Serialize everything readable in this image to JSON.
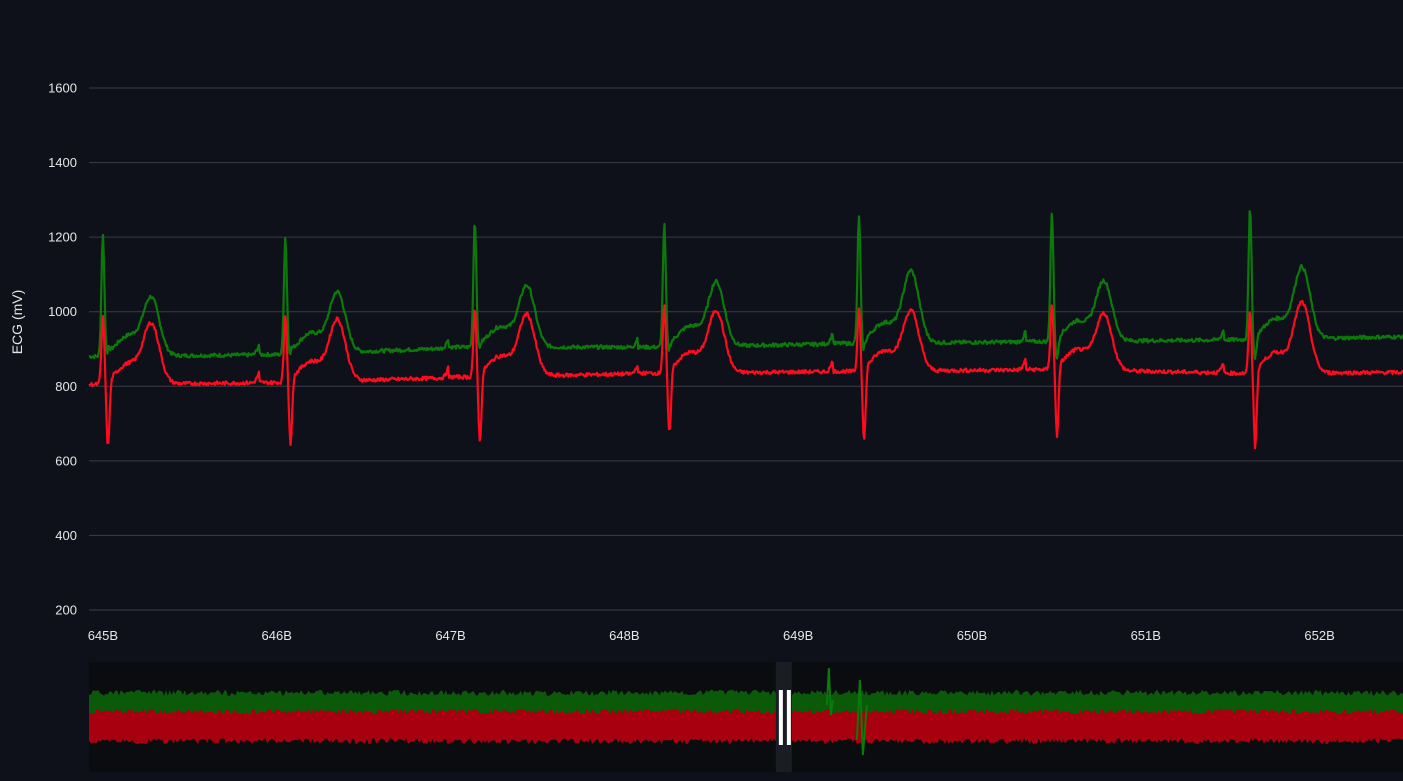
{
  "chart_data": {
    "type": "line",
    "ylabel": "ECG (mV)",
    "xlabel": "",
    "title": "",
    "ylim": [
      200,
      1600
    ],
    "yticks": [
      200,
      400,
      600,
      800,
      1000,
      1200,
      1400,
      1600
    ],
    "grid": true,
    "colors": {
      "background": "#0e1119",
      "green": "#0b7a0b",
      "red": "#ff0a1e"
    },
    "x_ticks": [
      {
        "label": "645B",
        "x": 645.0
      },
      {
        "label": "646B",
        "x": 646.0
      },
      {
        "label": "647B",
        "x": 647.0
      },
      {
        "label": "648B",
        "x": 648.0
      },
      {
        "label": "649B",
        "x": 649.0
      },
      {
        "label": "650B",
        "x": 650.0
      },
      {
        "label": "651B",
        "x": 651.0
      },
      {
        "label": "652B",
        "x": 652.0
      }
    ],
    "xlim": [
      644.92,
      652.48
    ],
    "series": [
      {
        "color": "#0b7a0b",
        "beats": [
          {
            "r_x": 645.0,
            "r_peak": 1205,
            "s_min": 890,
            "t_x": 645.28,
            "t_peak": 1030,
            "baseline": 880
          },
          {
            "r_x": 646.05,
            "r_peak": 1200,
            "s_min": 890,
            "t_x": 646.35,
            "t_peak": 1048,
            "baseline": 885
          },
          {
            "r_x": 647.14,
            "r_peak": 1245,
            "s_min": 900,
            "t_x": 647.44,
            "t_peak": 1065,
            "baseline": 905
          },
          {
            "r_x": 648.23,
            "r_peak": 1235,
            "s_min": 895,
            "t_x": 648.53,
            "t_peak": 1075,
            "baseline": 905
          },
          {
            "r_x": 649.35,
            "r_peak": 1258,
            "s_min": 895,
            "t_x": 649.65,
            "t_peak": 1105,
            "baseline": 915
          },
          {
            "r_x": 650.46,
            "r_peak": 1265,
            "s_min": 870,
            "t_x": 650.76,
            "t_peak": 1078,
            "baseline": 920
          },
          {
            "r_x": 651.6,
            "r_peak": 1275,
            "s_min": 870,
            "t_x": 651.9,
            "t_peak": 1115,
            "baseline": 925
          }
        ],
        "end_value": 935
      },
      {
        "color": "#ff0a1e",
        "beats": [
          {
            "r_x": 645.0,
            "r_peak": 985,
            "s_min": 630,
            "t_x": 645.28,
            "t_peak": 960,
            "baseline": 805
          },
          {
            "r_x": 646.05,
            "r_peak": 990,
            "s_min": 640,
            "t_x": 646.35,
            "t_peak": 975,
            "baseline": 810
          },
          {
            "r_x": 647.14,
            "r_peak": 1005,
            "s_min": 645,
            "t_x": 647.44,
            "t_peak": 988,
            "baseline": 825
          },
          {
            "r_x": 648.23,
            "r_peak": 1018,
            "s_min": 665,
            "t_x": 648.53,
            "t_peak": 998,
            "baseline": 835
          },
          {
            "r_x": 649.35,
            "r_peak": 1010,
            "s_min": 645,
            "t_x": 649.65,
            "t_peak": 998,
            "baseline": 840
          },
          {
            "r_x": 650.46,
            "r_peak": 1020,
            "s_min": 665,
            "t_x": 650.76,
            "t_peak": 990,
            "baseline": 845
          },
          {
            "r_x": 651.6,
            "r_peak": 998,
            "s_min": 632,
            "t_x": 651.9,
            "t_peak": 1020,
            "baseline": 835
          }
        ],
        "end_value": 838
      }
    ],
    "range_slider": {
      "present": true,
      "handle_position": 0.455,
      "green_band": [
        0.58,
        0.72
      ],
      "red_band": [
        0.28,
        0.55
      ]
    }
  }
}
